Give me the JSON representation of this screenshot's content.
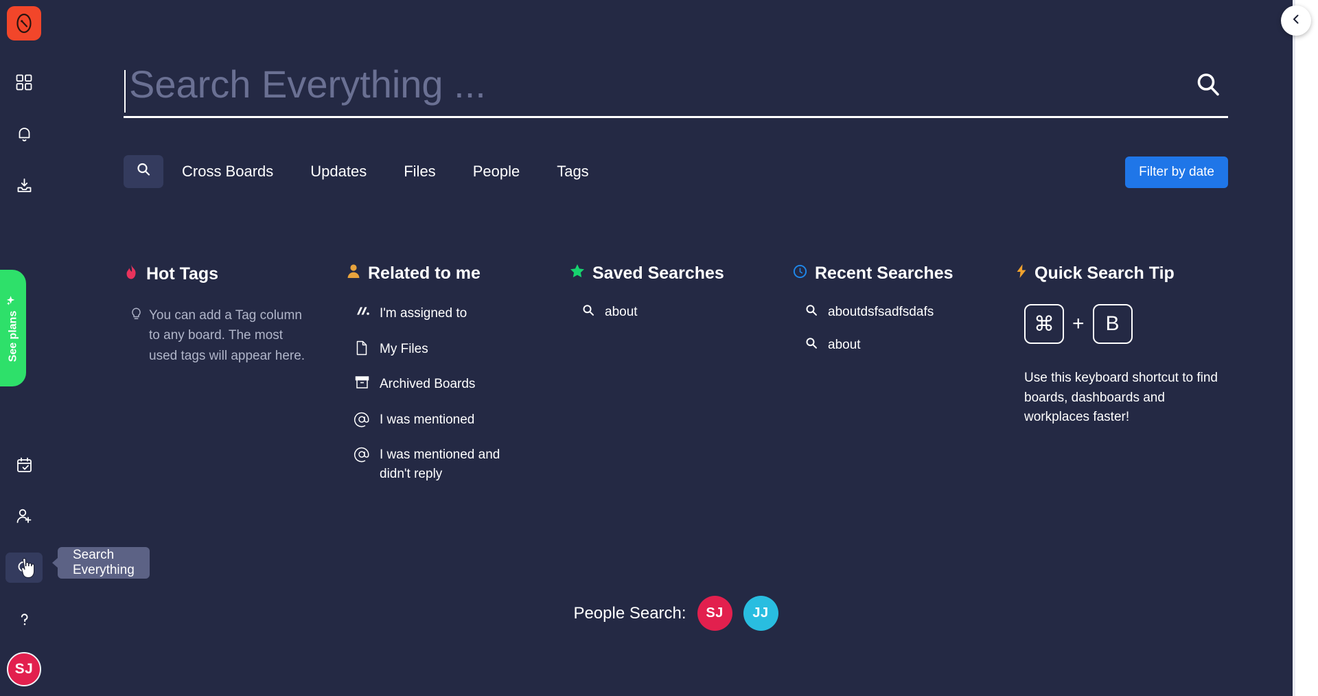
{
  "app": {
    "bg_color": "#242944",
    "accent_blue": "#1f76e8",
    "accent_green": "#2ee06a",
    "logo_color": "#f2462a"
  },
  "sidebar": {
    "logo_name": "monday-logo",
    "items": [
      {
        "name": "home-grid-icon",
        "label": "Home"
      },
      {
        "name": "bell-icon",
        "label": "Notifications"
      },
      {
        "name": "inbox-icon",
        "label": "Inbox"
      },
      {
        "name": "calendar-check-icon",
        "label": "My work"
      },
      {
        "name": "invite-user-icon",
        "label": "Invite members"
      },
      {
        "name": "search-everything-icon",
        "label": "Search Everything"
      },
      {
        "name": "help-icon",
        "label": "Help"
      }
    ],
    "see_plans_label": "See plans",
    "tooltip_label": "Search Everything",
    "avatar_initials": "SJ",
    "avatar_color": "#e2204e"
  },
  "search": {
    "placeholder": "Search Everything ...",
    "value": "",
    "submit_icon": "search-icon"
  },
  "tabs": [
    {
      "label": "",
      "icon": "search-icon",
      "active": true
    },
    {
      "label": "Cross Boards",
      "active": false
    },
    {
      "label": "Updates",
      "active": false
    },
    {
      "label": "Files",
      "active": false
    },
    {
      "label": "People",
      "active": false
    },
    {
      "label": "Tags",
      "active": false
    }
  ],
  "filter_button": {
    "label": "Filter by date"
  },
  "columns": {
    "hot_tags": {
      "title": "Hot Tags",
      "icon": "flame-icon",
      "tip": "You can add a Tag column to any board. The most used tags will appear here."
    },
    "related_to_me": {
      "title": "Related to me",
      "icon": "person-icon",
      "items": [
        {
          "label": "I'm assigned to",
          "icon": "assigned-icon"
        },
        {
          "label": "My Files",
          "icon": "file-icon"
        },
        {
          "label": "Archived Boards",
          "icon": "archive-icon"
        },
        {
          "label": "I was mentioned",
          "icon": "at-icon"
        },
        {
          "label": "I was mentioned and didn't reply",
          "icon": "at-icon"
        }
      ]
    },
    "saved_searches": {
      "title": "Saved Searches",
      "icon": "star-icon",
      "items": [
        {
          "label": "about",
          "icon": "search-icon"
        }
      ]
    },
    "recent_searches": {
      "title": "Recent Searches",
      "icon": "clock-icon",
      "items": [
        {
          "label": "aboutdsfsadfsdafs",
          "icon": "search-icon"
        },
        {
          "label": "about",
          "icon": "search-icon"
        }
      ]
    },
    "quick_search_tip": {
      "title": "Quick Search Tip",
      "icon": "lightning-icon",
      "key1": "⌘",
      "plus": "+",
      "key2": "B",
      "text": "Use this keyboard shortcut to find boards, dashboards and workplaces faster!"
    }
  },
  "people_search": {
    "label": "People Search:",
    "avatars": [
      {
        "initials": "SJ",
        "color": "#e2204e"
      },
      {
        "initials": "JJ",
        "color": "#29bde0"
      }
    ]
  },
  "collapse_button": {
    "icon": "chevron-left-icon",
    "label": "Collapse"
  }
}
